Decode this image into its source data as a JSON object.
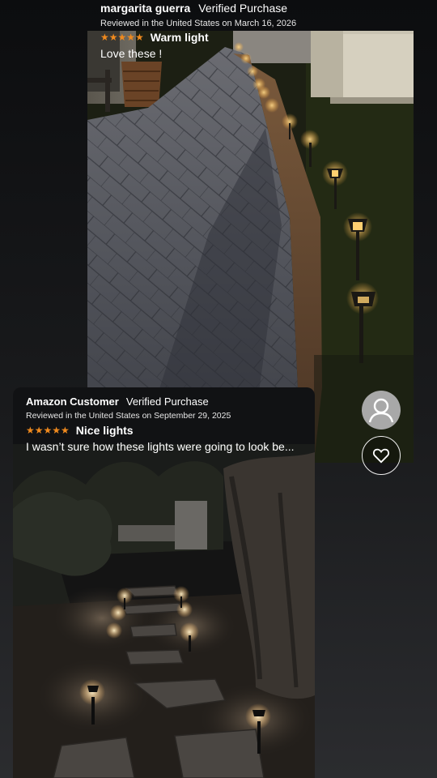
{
  "review1": {
    "reviewer": "margarita guerra",
    "verified": "Verified Purchase",
    "reviewed_line": "Reviewed in the United States on March 16, 2026",
    "stars": "★★★★★",
    "title": "Warm light",
    "body": "Love these !"
  },
  "review2": {
    "reviewer": "Amazon Customer",
    "verified": "Verified Purchase",
    "reviewed_line": "Reviewed in the United States on September 29, 2025",
    "stars": "★★★★★",
    "title": "Nice lights",
    "body": "I wasn’t sure how these lights were going to look be..."
  },
  "icons": {
    "avatar": "user-avatar-icon",
    "like": "heart-outline-icon",
    "star": "star-icon"
  },
  "colors": {
    "star": "#f08a1e",
    "avatar_bg": "#a8a8a8"
  }
}
